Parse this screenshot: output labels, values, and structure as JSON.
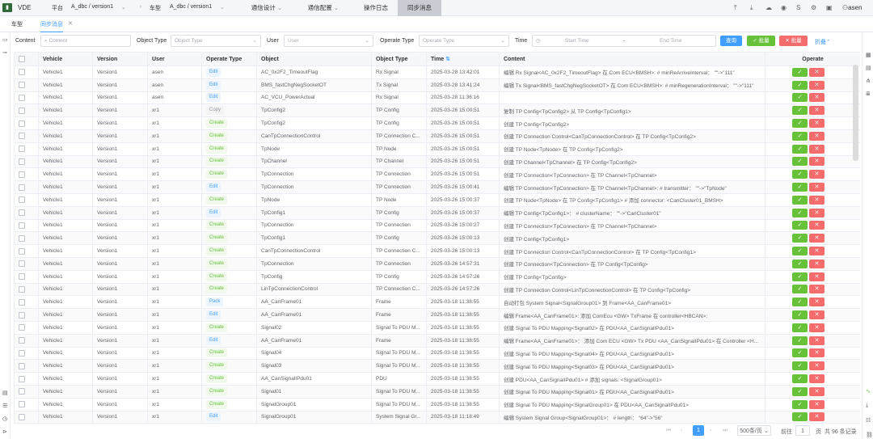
{
  "app": {
    "logo_text": "VDE",
    "title": "VDE"
  },
  "topbar": {
    "platform_label": "平台",
    "platform_value": "A_dbc / version1",
    "vehicle_label": "车型",
    "vehicle_value": "A_dbc / version1",
    "menus": [
      {
        "label": "通信设计",
        "active": false
      },
      {
        "label": "通信配置",
        "active": false
      },
      {
        "label": "操作日志",
        "active": false
      },
      {
        "label": "同步消息",
        "active": true
      }
    ],
    "user": "asen",
    "user_glyph": "S"
  },
  "tabs": [
    {
      "label": "车型",
      "active": false
    },
    {
      "label": "同步消息",
      "active": true,
      "closable": true
    }
  ],
  "filters": {
    "content_label": "Content",
    "content_placeholder": "Content",
    "object_type_label": "Object Type",
    "object_type_placeholder": "Object Type",
    "user_label": "User",
    "user_placeholder": "User",
    "operate_type_label": "Operate Type",
    "operate_type_placeholder": "Operate Type",
    "time_label": "Time",
    "start_placeholder": "Start Time",
    "end_placeholder": "End Time",
    "query_button": "查询",
    "approve_button": "✓ 批量",
    "reject_button": "✕ 批量",
    "fold_label": "折叠"
  },
  "table": {
    "headers": [
      "Vehicle",
      "Version",
      "User",
      "Operate Type",
      "Object",
      "Object Type",
      "Time",
      "Content",
      "Operate"
    ],
    "rows": [
      [
        "Vehicle1",
        "Version1",
        "asen",
        "Edit",
        "AC_0x2F2_TimeoutFlag",
        "Rx Signal",
        "2025-03-28 13:42:01",
        "编辑 Rx Signal<AC_0x2F2_TimeoutFlag> 在 Com ECU<BMSH>: # minReArriveInterval： \"\"->\"111\""
      ],
      [
        "Vehicle1",
        "Version1",
        "asen",
        "Edit",
        "BMS_fastChgNegSocketOT",
        "Tx Signal",
        "2025-03-28 13:41:24",
        "编辑 Tx Signal<BMS_fastChgNegSocketOT> 在 Com ECU<BMSH>: # minRegenerationInterval： \"\"->\"111\""
      ],
      [
        "Vehicle1",
        "Version1",
        "asen",
        "Edit",
        "AC_VCU_PowerActual",
        "Rx Signal",
        "2025-03-28 11:36:16",
        ""
      ],
      [
        "Vehicle1",
        "Version1",
        "xr1",
        "Copy",
        "TpConfig2",
        "TP Config",
        "2025-03-26 15:00:51",
        "复制 TP Config<TpConfig2> 从 TP Config<TpConfig1>"
      ],
      [
        "Vehicle1",
        "Version1",
        "xr1",
        "Create",
        "TpConfig2",
        "TP Config",
        "2025-03-26 15:00:51",
        "创建 TP Config<TpConfig2>"
      ],
      [
        "Vehicle1",
        "Version1",
        "xr1",
        "Create",
        "CanTpConnectionControl",
        "TP Connection C...",
        "2025-03-26 15:00:51",
        "创建 TP Connection Control<CanTpConnectionControl> 在 TP Config<TpConfig2>"
      ],
      [
        "Vehicle1",
        "Version1",
        "xr1",
        "Create",
        "TpNode",
        "TP Node",
        "2025-03-26 15:00:51",
        "创建 TP Node<TpNode> 在 TP Config<TpConfig2>"
      ],
      [
        "Vehicle1",
        "Version1",
        "xr1",
        "Create",
        "TpChannel",
        "TP Channel",
        "2025-03-26 15:00:51",
        "创建 TP Channel<TpChannel> 在 TP Config<TpConfig2>"
      ],
      [
        "Vehicle1",
        "Version1",
        "xr1",
        "Create",
        "TpConnection",
        "TP Connection",
        "2025-03-26 15:00:51",
        "创建 TP Connection<TpConnection> 在 TP Channel<TpChannel>"
      ],
      [
        "Vehicle1",
        "Version1",
        "xr1",
        "Edit",
        "TpConnection",
        "TP Connection",
        "2025-03-26 15:00:41",
        "编辑 TP Connection<TpConnection> 在 TP Channel<TpChannel>: # transmitter： \"\"->\"TpNode\""
      ],
      [
        "Vehicle1",
        "Version1",
        "xr1",
        "Create",
        "TpNode",
        "TP Node",
        "2025-03-26 15:00:37",
        "创建 TP Node<TpNode> 在 TP Config<TpConfig1> # 添加 connector: <CanCluster01_BMSH>"
      ],
      [
        "Vehicle1",
        "Version1",
        "xr1",
        "Edit",
        "TpConfig1",
        "TP Config",
        "2025-03-26 15:00:37",
        "编辑 TP Config<TpConfig1>： # clusterName： \"\"->\"CanCluster01\""
      ],
      [
        "Vehicle1",
        "Version1",
        "xr1",
        "Create",
        "TpConnection",
        "TP Connection",
        "2025-03-26 15:00:27",
        "创建 TP Connection<TpConnection> 在 TP Channel<TpChannel>"
      ],
      [
        "Vehicle1",
        "Version1",
        "xr1",
        "Create",
        "TpConfig1",
        "TP Config",
        "2025-03-26 15:00:13",
        "创建 TP Config<TpConfig1>"
      ],
      [
        "Vehicle1",
        "Version1",
        "xr1",
        "Create",
        "CanTpConnectionControl",
        "TP Connection C...",
        "2025-03-26 15:00:13",
        "创建 TP Connection Control<CanTpConnectionControl> 在 TP Config<TpConfig1>"
      ],
      [
        "Vehicle1",
        "Version1",
        "xr1",
        "Create",
        "TpConnection",
        "TP Connection",
        "2025-03-26 14:57:31",
        "创建 TP Connection<TpConnection> 在 TP Config<TpConfig>"
      ],
      [
        "Vehicle1",
        "Version1",
        "xr1",
        "Create",
        "TpConfig",
        "TP Config",
        "2025-03-26 14:57:26",
        "创建 TP Config<TpConfig>"
      ],
      [
        "Vehicle1",
        "Version1",
        "xr1",
        "Create",
        "LinTpConnectionControl",
        "TP Connection C...",
        "2025-03-26 14:57:26",
        "创建 TP Connection Control<LinTpConnectionControl> 在 TP Config<TpConfig>"
      ],
      [
        "Vehicle1",
        "Version1",
        "xr1",
        "Pack",
        "AA_CanFrame01",
        "Frame",
        "2025-03-18 11:38:55",
        "自动打包 System Signal<SignalGroup01> 到 Frame<AA_CanFrame01>"
      ],
      [
        "Vehicle1",
        "Version1",
        "xr1",
        "Edit",
        "AA_CanFrame01",
        "Frame",
        "2025-03-18 11:38:55",
        "编辑 Frame<AA_CanFrame01>: 添加 ComEcu <GW> TxFrame 在 controller<HBCAN>;"
      ],
      [
        "Vehicle1",
        "Version1",
        "xr1",
        "Create",
        "Signal02",
        "Signal To PDU M...",
        "2025-03-18 11:38:55",
        "创建 Signal To PDU Mapping<Signal02> 在 PDU<AA_CanSignalIPdu01>"
      ],
      [
        "Vehicle1",
        "Version1",
        "xr1",
        "Edit",
        "AA_CanFrame01",
        "Frame",
        "2025-03-18 11:38:55",
        "编辑 Frame<AA_CanFrame01>： 添加 Com ECU <GW> Tx PDU <AA_CanSignalIPdu01> 在 Controller <H..."
      ],
      [
        "Vehicle1",
        "Version1",
        "xr1",
        "Create",
        "Signal04",
        "Signal To PDU M...",
        "2025-03-18 11:38:55",
        "创建 Signal To PDU Mapping<Signal04> 在 PDU<AA_CanSignalIPdu01>"
      ],
      [
        "Vehicle1",
        "Version1",
        "xr1",
        "Create",
        "Signal03",
        "Signal To PDU M...",
        "2025-03-18 11:38:55",
        "创建 Signal To PDU Mapping<Signal03> 在 PDU<AA_CanSignalIPdu01>"
      ],
      [
        "Vehicle1",
        "Version1",
        "xr1",
        "Create",
        "AA_CanSignalIPdu01",
        "PDU",
        "2025-03-18 11:38:55",
        "创建 PDU<AA_CanSignalIPdu01> # 添加 signals: <SignalGroup01>"
      ],
      [
        "Vehicle1",
        "Version1",
        "xr1",
        "Create",
        "Signal01",
        "Signal To PDU M...",
        "2025-03-18 11:38:55",
        "创建 Signal To PDU Mapping<Signal01> 在 PDU<AA_CanSignalIPdu01>"
      ],
      [
        "Vehicle1",
        "Version1",
        "xr1",
        "Create",
        "SignalGroup01",
        "Signal To PDU M...",
        "2025-03-18 11:38:55",
        "创建 Signal To PDU Mapping<SignalGroup01> 在 PDU<AA_CanSignalIPdu01>"
      ],
      [
        "Vehicle1",
        "Version1",
        "xr1",
        "Edit",
        "SignalGroup01",
        "System Signal Gr...",
        "2025-03-18 11:18:49",
        "编辑 System Signal Group<SignalGroup01>： # length： \"64\"->\"56\""
      ]
    ]
  },
  "pagination": {
    "current_page": "1",
    "page_size": "500条/页",
    "goto_label": "前往",
    "goto_value": "1",
    "page_unit": "页",
    "total": "共 96 条记录"
  }
}
